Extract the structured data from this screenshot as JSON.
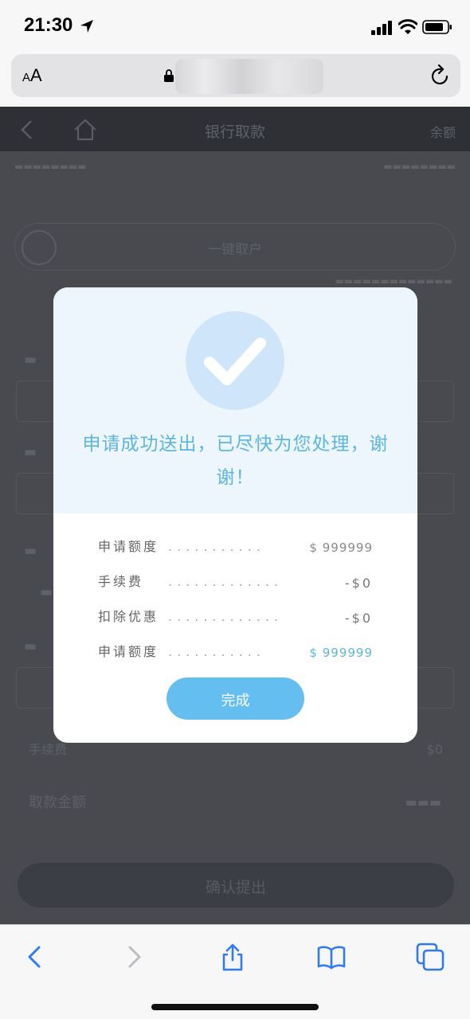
{
  "status_bar": {
    "time": "21:30"
  },
  "address_bar": {
    "text_size_small": "A",
    "text_size_large": "A"
  },
  "background_page": {
    "title": "银行取款",
    "balance_link": "余额",
    "card_label": "一键取户",
    "fee_label": "手续费",
    "fee_value": "$0",
    "amount_label": "取款金额",
    "confirm_label": "确认提出"
  },
  "modal": {
    "message": "申请成功送出，已尽快为您处理，谢谢！",
    "rows": [
      {
        "label": "申请额度",
        "value": "$ 999999"
      },
      {
        "label": "手续费",
        "value": "-$0"
      },
      {
        "label": "扣除优惠",
        "value": "-$0"
      },
      {
        "label": "申请额度",
        "value": "$ 999999"
      }
    ],
    "dots_short": "...........",
    "dots_long": ".............",
    "done_label": "完成"
  },
  "colors": {
    "accent": "#5db6dd",
    "button": "#64bff0",
    "overlay": "#484a50",
    "modal_header": "#eef6fd",
    "ios_blue": "#2f7bf6"
  }
}
